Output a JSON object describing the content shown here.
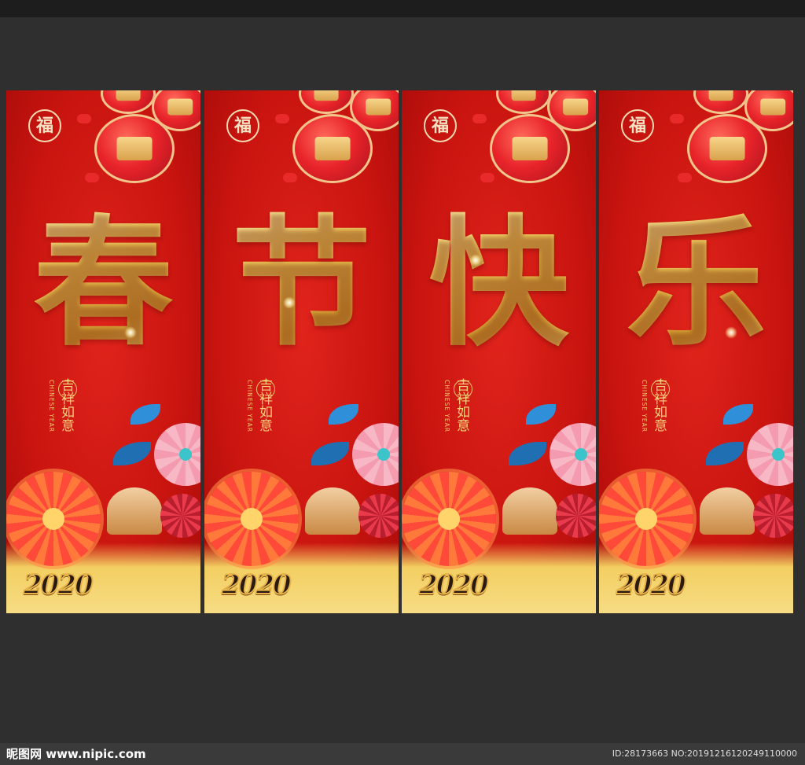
{
  "panels": [
    {
      "character": "春",
      "fu": "福",
      "vertical_en": "CHINESE YEAR",
      "vertical_cn": [
        "吉",
        "祥",
        "如",
        "意"
      ],
      "year": "2020"
    },
    {
      "character": "节",
      "fu": "福",
      "vertical_en": "CHINESE YEAR",
      "vertical_cn": [
        "吉",
        "祥",
        "如",
        "意"
      ],
      "year": "2020"
    },
    {
      "character": "快",
      "fu": "福",
      "vertical_en": "CHINESE YEAR",
      "vertical_cn": [
        "吉",
        "祥",
        "如",
        "意"
      ],
      "year": "2020"
    },
    {
      "character": "乐",
      "fu": "福",
      "vertical_en": "CHINESE YEAR",
      "vertical_cn": [
        "吉",
        "祥",
        "如",
        "意"
      ],
      "year": "2020"
    }
  ],
  "footer": {
    "logo": "昵图网 www.nipic.com",
    "watermark": "ID:28173663 NO:20191216120249110000"
  },
  "colors": {
    "background": "#2b2b2b",
    "panel_red": "#c9140f",
    "gold": "#f2cf6e"
  }
}
